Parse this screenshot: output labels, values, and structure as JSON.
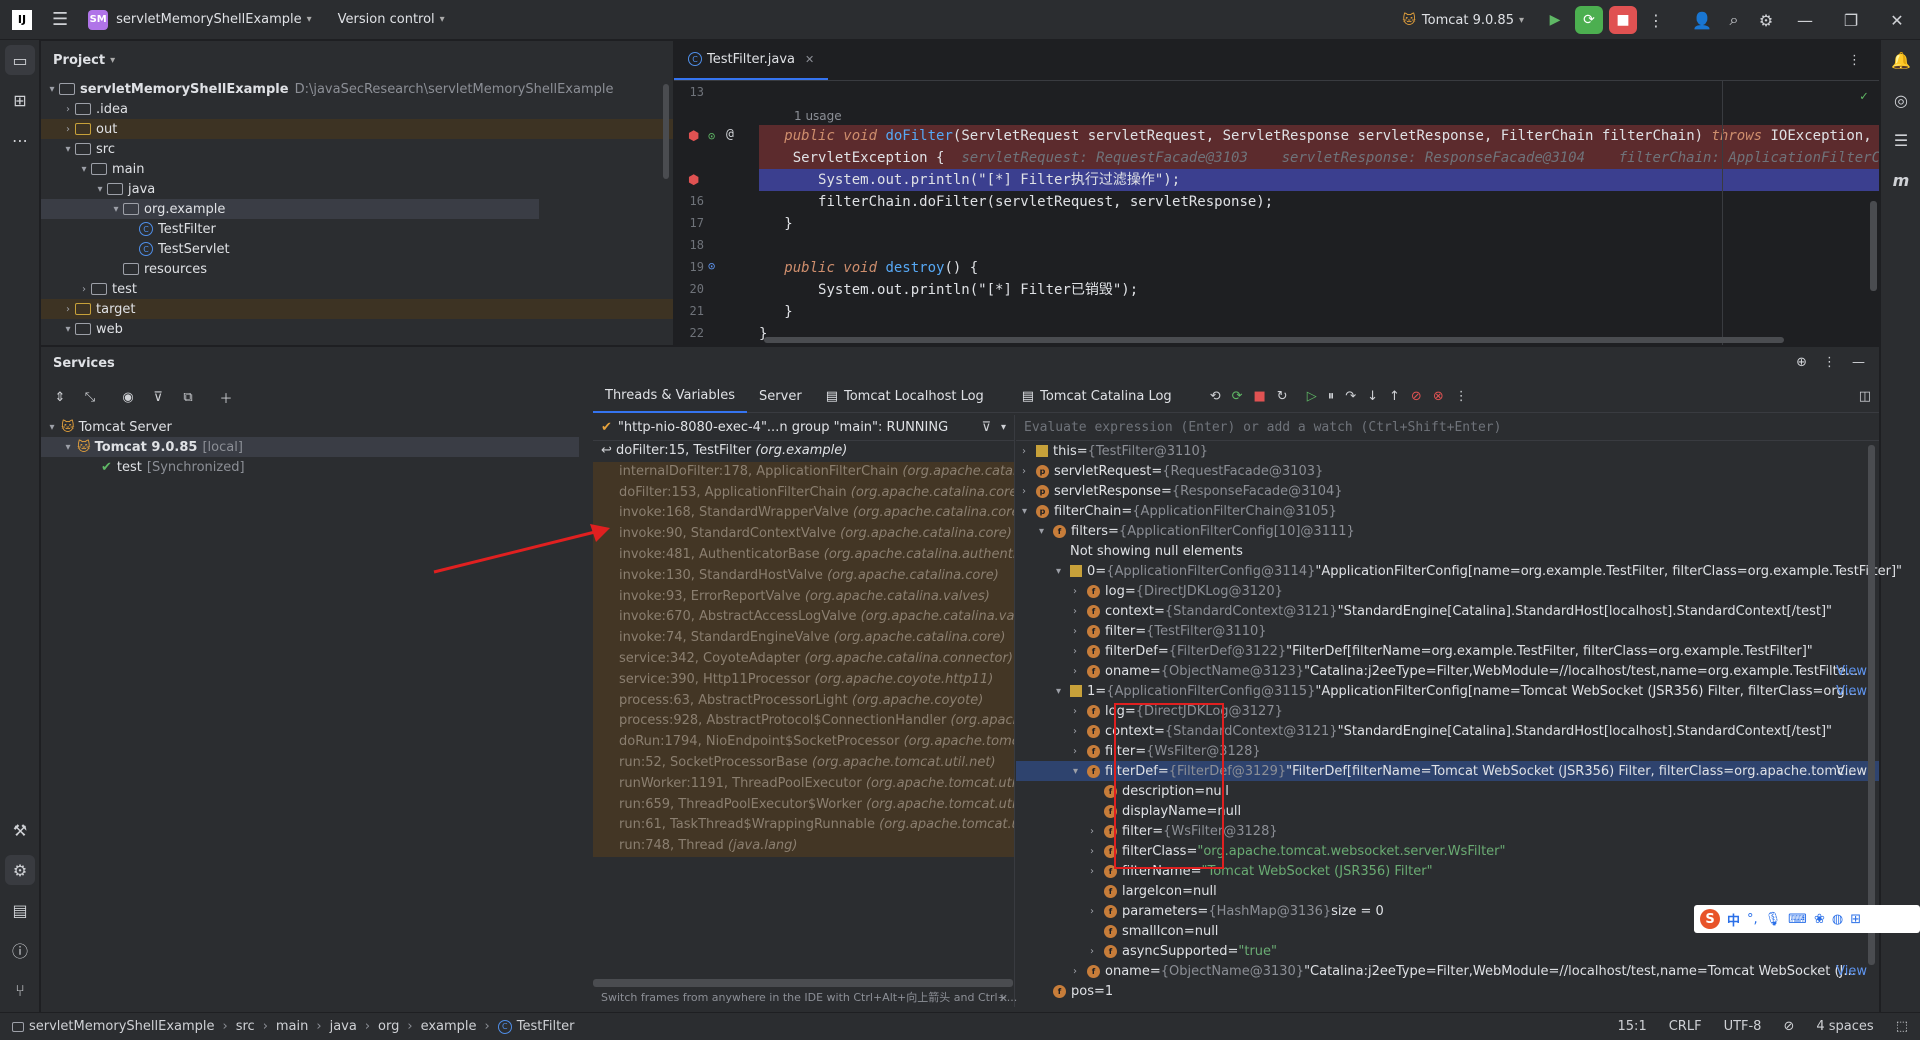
{
  "titlebar": {
    "app_logo": "IJ",
    "project_badge": "SM",
    "project_name": "servletMemoryShellExample",
    "vcs_label": "Version control",
    "run_config": "Tomcat 9.0.85"
  },
  "project_panel": {
    "title": "Project",
    "tree": [
      {
        "label": "servletMemoryShellExample",
        "suffix": "D:\\javaSecResearch\\servletMemoryShellExample",
        "indent": 0,
        "expanded": true
      },
      {
        "label": ".idea",
        "indent": 1,
        "expanded": false
      },
      {
        "label": "out",
        "indent": 1,
        "expanded": false,
        "excluded": true
      },
      {
        "label": "src",
        "indent": 1,
        "expanded": true
      },
      {
        "label": "main",
        "indent": 2,
        "expanded": true
      },
      {
        "label": "java",
        "indent": 3,
        "expanded": true
      },
      {
        "label": "org.example",
        "indent": 4,
        "expanded": true,
        "selected": true
      },
      {
        "label": "TestFilter",
        "indent": 5,
        "class": true
      },
      {
        "label": "TestServlet",
        "indent": 5,
        "class": true
      },
      {
        "label": "resources",
        "indent": 4,
        "leaf": true
      },
      {
        "label": "test",
        "indent": 2,
        "expanded": false
      },
      {
        "label": "target",
        "indent": 1,
        "expanded": false,
        "excluded": true
      },
      {
        "label": "web",
        "indent": 1,
        "expanded": true
      }
    ]
  },
  "editor": {
    "tab": "TestFilter.java",
    "usage": "1 usage",
    "line_numbers": [
      "13",
      "",
      "",
      "",
      "16",
      "17",
      "18",
      "19",
      "20",
      "21",
      "22"
    ],
    "code": {
      "l14a_kw": "public void ",
      "l14a_fn": "doFilter",
      "l14a_rest": "(ServletRequest servletRequest, ServletResponse servletResponse, FilterChain filterChain) ",
      "l14a_throws": "throws",
      "l14a_exc": " IOException,",
      "l14b": " ServletException {",
      "l14b_hint": "servletRequest: RequestFacade@3103    servletResponse: ResponseFacade@3104    filterChain: ApplicationFilterChain@",
      "l15": "    System.out.println(\"[*] Filter执行过滤操作\");",
      "l16": "    filterChain.doFilter(servletRequest, servletResponse);",
      "l17": "}",
      "l19_kw": "public void ",
      "l19_fn": "destroy",
      "l19_rest": "() {",
      "l20": "    System.out.println(\"[*] Filter已销毁\");",
      "l21": "}",
      "l22": "}"
    }
  },
  "services": {
    "title": "Services",
    "tree": {
      "server": "Tomcat Server",
      "instance": "Tomcat 9.0.85",
      "instance_suffix": "[local]",
      "artifact": "test",
      "artifact_suffix": "[Synchronized]"
    },
    "tabs": [
      "Threads & Variables",
      "Server",
      "Tomcat Localhost Log",
      "Tomcat Catalina Log"
    ],
    "thread": "\"http-nio-8080-exec-4\"...n group \"main\": RUNNING",
    "frames": [
      {
        "m": "doFilter:15, TestFilter",
        "p": "(org.example)"
      },
      {
        "m": "internalDoFilter:178, ApplicationFilterChain",
        "p": "(org.apache.catalina"
      },
      {
        "m": "doFilter:153, ApplicationFilterChain",
        "p": "(org.apache.catalina.core)"
      },
      {
        "m": "invoke:168, StandardWrapperValve",
        "p": "(org.apache.catalina.core)"
      },
      {
        "m": "invoke:90, StandardContextValve",
        "p": "(org.apache.catalina.core)"
      },
      {
        "m": "invoke:481, AuthenticatorBase",
        "p": "(org.apache.catalina.authenticat"
      },
      {
        "m": "invoke:130, StandardHostValve",
        "p": "(org.apache.catalina.core)"
      },
      {
        "m": "invoke:93, ErrorReportValve",
        "p": "(org.apache.catalina.valves)"
      },
      {
        "m": "invoke:670, AbstractAccessLogValve",
        "p": "(org.apache.catalina.valve"
      },
      {
        "m": "invoke:74, StandardEngineValve",
        "p": "(org.apache.catalina.core)"
      },
      {
        "m": "service:342, CoyoteAdapter",
        "p": "(org.apache.catalina.connector)"
      },
      {
        "m": "service:390, Http11Processor",
        "p": "(org.apache.coyote.http11)"
      },
      {
        "m": "process:63, AbstractProcessorLight",
        "p": "(org.apache.coyote)"
      },
      {
        "m": "process:928, AbstractProtocol$ConnectionHandler",
        "p": "(org.apache"
      },
      {
        "m": "doRun:1794, NioEndpoint$SocketProcessor",
        "p": "(org.apache.tomca"
      },
      {
        "m": "run:52, SocketProcessorBase",
        "p": "(org.apache.tomcat.util.net)"
      },
      {
        "m": "runWorker:1191, ThreadPoolExecutor",
        "p": "(org.apache.tomcat.util"
      },
      {
        "m": "run:659, ThreadPoolExecutor$Worker",
        "p": "(org.apache.tomcat.util.t"
      },
      {
        "m": "run:61, TaskThread$WrappingRunnable",
        "p": "(org.apache.tomcat.util"
      },
      {
        "m": "run:748, Thread",
        "p": "(java.lang)"
      }
    ],
    "frames_hint": "Switch frames from anywhere in the IDE with Ctrl+Alt+向上箭头 and Ctrl+...",
    "watch_placeholder": "Evaluate expression (Enter) or add a watch (Ctrl+Shift+Enter)",
    "vars": [
      {
        "d": 0,
        "exp": ">",
        "ic": "list",
        "n": "this",
        "t": "{TestFilter@3110}",
        "v": ""
      },
      {
        "d": 0,
        "exp": ">",
        "ic": "p",
        "n": "servletRequest",
        "t": "{RequestFacade@3103}",
        "v": ""
      },
      {
        "d": 0,
        "exp": ">",
        "ic": "p",
        "n": "servletResponse",
        "t": "{ResponseFacade@3104}",
        "v": ""
      },
      {
        "d": 0,
        "exp": "v",
        "ic": "p",
        "n": "filterChain",
        "t": "{ApplicationFilterChain@3105}",
        "v": ""
      },
      {
        "d": 1,
        "exp": "v",
        "ic": "f",
        "n": "filters",
        "t": "{ApplicationFilterConfig[10]@3111}",
        "v": ""
      },
      {
        "d": 2,
        "exp": "",
        "ic": "",
        "n": "Not showing null elements",
        "t": "",
        "v": ""
      },
      {
        "d": 2,
        "exp": "v",
        "ic": "list",
        "n": "0",
        "t": "{ApplicationFilterConfig@3114}",
        "v": "\"ApplicationFilterConfig[name=org.example.TestFilter, filterClass=org.example.TestFilter]\""
      },
      {
        "d": 3,
        "exp": ">",
        "ic": "f",
        "n": "log",
        "t": "{DirectJDKLog@3120}",
        "v": ""
      },
      {
        "d": 3,
        "exp": ">",
        "ic": "f",
        "n": "context",
        "t": "{StandardContext@3121}",
        "v": "\"StandardEngine[Catalina].StandardHost[localhost].StandardContext[/test]\""
      },
      {
        "d": 3,
        "exp": ">",
        "ic": "f",
        "n": "filter",
        "t": "{TestFilter@3110}",
        "v": ""
      },
      {
        "d": 3,
        "exp": ">",
        "ic": "f",
        "n": "filterDef",
        "t": "{FilterDef@3122}",
        "v": "\"FilterDef[filterName=org.example.TestFilter, filterClass=org.example.TestFilter]\""
      },
      {
        "d": 3,
        "exp": ">",
        "ic": "f",
        "n": "oname",
        "t": "{ObjectName@3123}",
        "v": "\"Catalina:j2eeType=Filter,WebModule=//localhost/test,name=org.example.TestFilte...",
        "view": "View"
      },
      {
        "d": 2,
        "exp": "v",
        "ic": "list",
        "n": "1",
        "t": "{ApplicationFilterConfig@3115}",
        "v": "\"ApplicationFilterConfig[name=Tomcat WebSocket (JSR356) Filter, filterClass=org....",
        "view": "View"
      },
      {
        "d": 3,
        "exp": ">",
        "ic": "f",
        "n": "log",
        "t": "{DirectJDKLog@3127}",
        "v": ""
      },
      {
        "d": 3,
        "exp": ">",
        "ic": "f",
        "n": "context",
        "t": "{StandardContext@3121}",
        "v": "\"StandardEngine[Catalina].StandardHost[localhost].StandardContext[/test]\""
      },
      {
        "d": 3,
        "exp": ">",
        "ic": "f",
        "n": "filter",
        "t": "{WsFilter@3128}",
        "v": ""
      },
      {
        "d": 3,
        "exp": "v",
        "ic": "f",
        "n": "filterDef",
        "t": "{FilterDef@3129}",
        "v": "\"FilterDef[filterName=Tomcat WebSocket (JSR356) Filter, filterClass=org.apache.tomc...",
        "view": "View",
        "sel": true
      },
      {
        "d": 4,
        "exp": "",
        "ic": "f",
        "n": "description",
        "t": "",
        "v": "null"
      },
      {
        "d": 4,
        "exp": "",
        "ic": "f",
        "n": "displayName",
        "t": "",
        "v": "null"
      },
      {
        "d": 4,
        "exp": ">",
        "ic": "f",
        "n": "filter",
        "t": "{WsFilter@3128}",
        "v": ""
      },
      {
        "d": 4,
        "exp": ">",
        "ic": "f",
        "n": "filterClass",
        "t": "",
        "v": "\"org.apache.tomcat.websocket.server.WsFilter\""
      },
      {
        "d": 4,
        "exp": ">",
        "ic": "f",
        "n": "filterName",
        "t": "",
        "v": "\"Tomcat WebSocket (JSR356) Filter\""
      },
      {
        "d": 4,
        "exp": "",
        "ic": "f",
        "n": "largeIcon",
        "t": "",
        "v": "null"
      },
      {
        "d": 4,
        "exp": ">",
        "ic": "f",
        "n": "parameters",
        "t": "{HashMap@3136}",
        "v": "size = 0"
      },
      {
        "d": 4,
        "exp": "",
        "ic": "f",
        "n": "smallIcon",
        "t": "",
        "v": "null"
      },
      {
        "d": 4,
        "exp": ">",
        "ic": "f",
        "n": "asyncSupported",
        "t": "",
        "v": "\"true\""
      },
      {
        "d": 3,
        "exp": ">",
        "ic": "f",
        "n": "oname",
        "t": "{ObjectName@3130}",
        "v": "\"Catalina:j2eeType=Filter,WebModule=//localhost/test,name=Tomcat WebSocket (J...",
        "view": "View"
      },
      {
        "d": 1,
        "exp": "",
        "ic": "f",
        "n": "pos",
        "t": "",
        "v": "1"
      }
    ]
  },
  "statusbar": {
    "crumbs": [
      "servletMemoryShellExample",
      "src",
      "main",
      "java",
      "org",
      "example",
      "TestFilter"
    ],
    "position": "15:1",
    "line_sep": "CRLF",
    "encoding": "UTF-8",
    "indent": "4 spaces"
  },
  "ime": {
    "label": "中"
  }
}
